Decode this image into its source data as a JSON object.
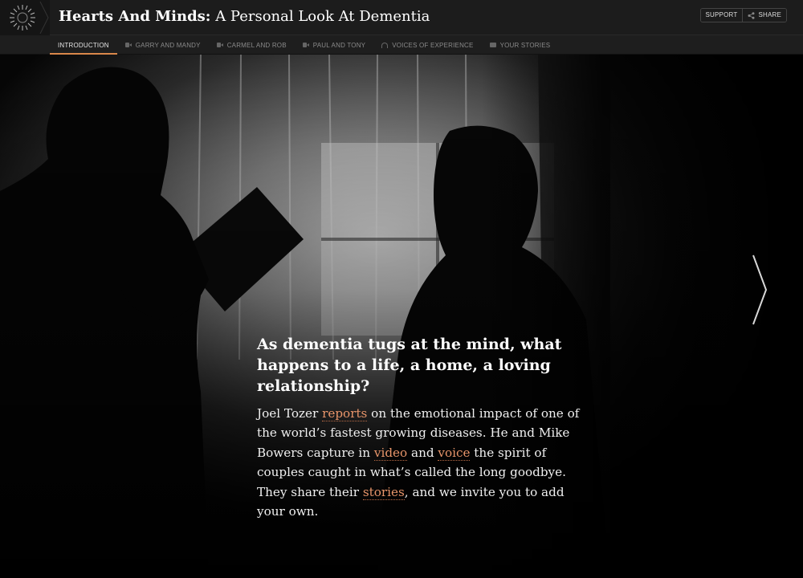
{
  "header": {
    "title_bold": "Hearts And Minds:",
    "title_rest": "A Personal Look At Dementia",
    "support_label": "SUPPORT",
    "share_label": "SHARE"
  },
  "nav": {
    "tabs": [
      {
        "label": "INTRODUCTION",
        "icon": "",
        "active": true
      },
      {
        "label": "GARRY AND MANDY",
        "icon": "video-icon"
      },
      {
        "label": "CARMEL AND ROB",
        "icon": "video-icon"
      },
      {
        "label": "PAUL AND TONY",
        "icon": "video-icon"
      },
      {
        "label": "VOICES OF EXPERIENCE",
        "icon": "audio-icon"
      },
      {
        "label": "YOUR STORIES",
        "icon": "chat-icon"
      }
    ]
  },
  "story": {
    "headline": "As dementia tugs at the mind, what happens to a life, a home, a loving relationship?",
    "t1": "Joel Tozer ",
    "link_reports": "reports",
    "t2": " on the emotional impact of one of the world’s fastest growing diseases. He and Mike Bowers capture in ",
    "link_video": "video",
    "t3": " and ",
    "link_voice": "voice",
    "t4": " the spirit of couples caught in what’s called the long goodbye. They share their ",
    "link_stories": "stories",
    "t5": ", and we invite you to add your own."
  },
  "colors": {
    "accent": "#d9874a",
    "link": "#e8956a",
    "header_bg": "#1c1c1c"
  }
}
